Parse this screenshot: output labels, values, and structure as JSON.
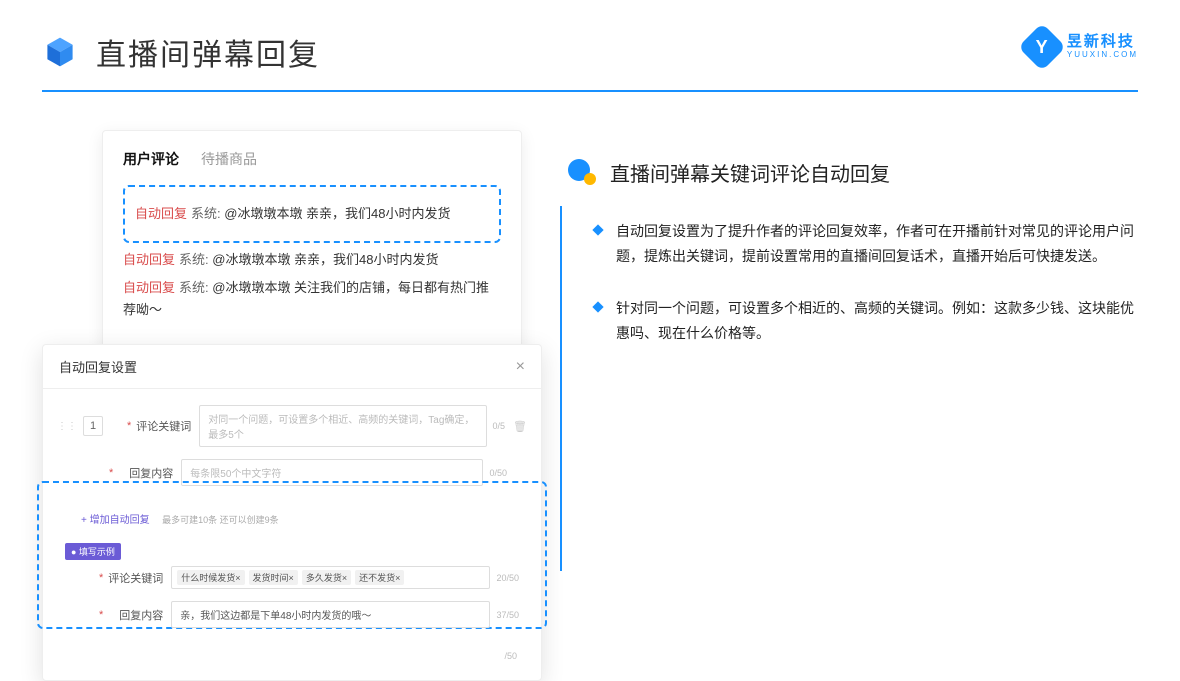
{
  "header": {
    "title": "直播间弹幕回复",
    "brand_top": "昱新科技",
    "brand_bot": "YUUXIN.COM",
    "brand_letter": "Y"
  },
  "comments": {
    "tab_active": "用户评论",
    "tab_inactive": "待播商品",
    "rows": [
      {
        "label": "自动回复",
        "sys": "系统: ",
        "text": "@冰墩墩本墩 亲亲，我们48小时内发货"
      },
      {
        "label": "自动回复",
        "sys": "系统: ",
        "text": "@冰墩墩本墩 亲亲，我们48小时内发货"
      },
      {
        "label": "自动回复",
        "sys": "系统: ",
        "text": "@冰墩墩本墩 关注我们的店铺，每日都有热门推荐呦～"
      }
    ]
  },
  "dialog": {
    "title": "自动回复设置",
    "num": "1",
    "label_keyword": "评论关键词",
    "ph_keyword": "对同一个问题，可设置多个相近、高频的关键词，Tag确定，最多5个",
    "cnt_keyword": "0/5",
    "label_content": "回复内容",
    "ph_content": "每条限50个中文字符",
    "cnt_content": "0/50",
    "add_link": "+ 增加自动回复",
    "add_hint": "最多可建10条 还可以创建9条",
    "example_badge": "● 填写示例",
    "ex_label_kw": "评论关键词",
    "ex_tags": [
      "什么时候发货×",
      "发货时间×",
      "多久发货×",
      "还不发货×"
    ],
    "ex_cnt_kw": "20/50",
    "ex_label_ct": "回复内容",
    "ex_content": "亲，我们这边都是下单48小时内发货的哦～",
    "ex_cnt_ct": "37/50",
    "bot_cnt": "/50"
  },
  "right": {
    "section_title": "直播间弹幕关键词评论自动回复",
    "bullets": [
      "自动回复设置为了提升作者的评论回复效率，作者可在开播前针对常见的评论用户问题，提炼出关键词，提前设置常用的直播间回复话术，直播开始后可快捷发送。",
      "针对同一个问题，可设置多个相近的、高频的关键词。例如：这款多少钱、这块能优惠吗、现在什么价格等。"
    ]
  }
}
